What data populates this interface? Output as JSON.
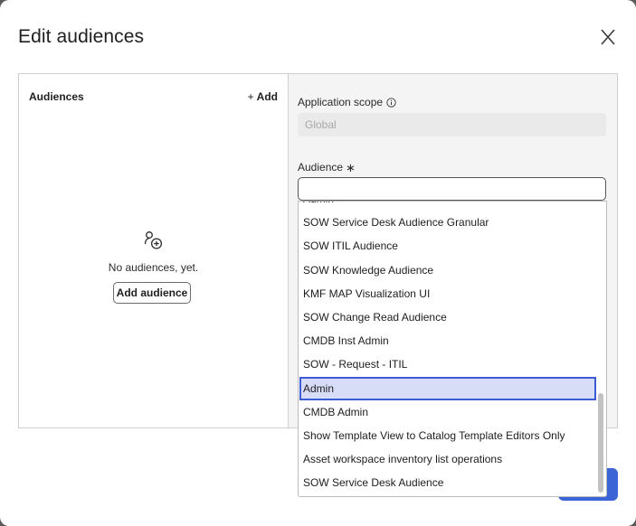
{
  "dialog": {
    "title": "Edit audiences",
    "close_icon": "close-icon"
  },
  "left_pane": {
    "title": "Audiences",
    "add_link_plus": "+",
    "add_link_label": "Add",
    "empty_icon": "add-user-icon",
    "empty_text": "No audiences, yet.",
    "add_audience_button": "Add audience"
  },
  "right_pane": {
    "scope_label": "Application scope",
    "scope_info_icon": "info-icon",
    "scope_value": "Global",
    "audience_label": "Audience",
    "audience_required_mark": "∗",
    "audience_value": ""
  },
  "dropdown": {
    "options": [
      "Admin",
      "SOW Service Desk Audience Granular",
      "SOW ITIL Audience",
      "SOW Knowledge Audience",
      "KMF MAP Visualization UI",
      "SOW Change Read Audience",
      "CMDB Inst Admin",
      "SOW - Request - ITIL",
      "Admin",
      "CMDB Admin",
      "Show Template View to Catalog Template Editors Only",
      "Asset workspace inventory list operations",
      "SOW Service Desk Audience"
    ],
    "selected_index": 8
  },
  "colors": {
    "primary": "#3b64d6",
    "selected_bg": "#d7dcf7",
    "selected_border": "#3e5bd3",
    "pane_bg": "#f4f4f4"
  }
}
